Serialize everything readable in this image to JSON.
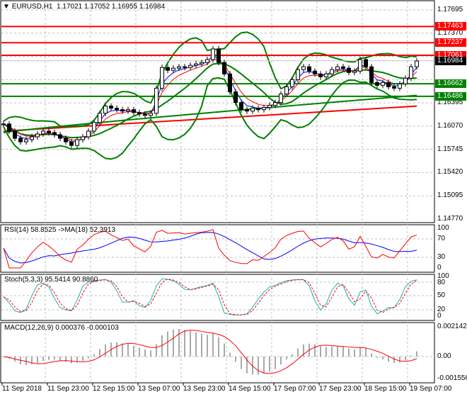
{
  "header": {
    "symbol": "EURUSD,H1",
    "open": "1.17021",
    "high": "1.17052",
    "low": "1.16955",
    "close": "1.16984"
  },
  "price_axis": [
    "1.17695",
    "1.17370",
    "1.16395",
    "1.16070",
    "1.15745",
    "1.15420",
    "1.15095",
    "1.14770"
  ],
  "levels": [
    {
      "price": 1.17463,
      "label": "1.17463",
      "color": "#ff0000"
    },
    {
      "price": 1.17237,
      "label": "1.17237",
      "color": "#ff0000"
    },
    {
      "price": 1.17061,
      "label": "1.17061",
      "color": "#ff0000"
    },
    {
      "price": 1.16662,
      "label": "1.16662",
      "color": "#008000"
    },
    {
      "price": 1.16486,
      "label": "1.16486",
      "color": "#008000"
    }
  ],
  "current_price": {
    "price": 1.16984,
    "label": "1.16984"
  },
  "rsi": {
    "title": "RSI(14) 58.8525  ->MA(18) 52.3913",
    "axis": [
      "100",
      "70",
      "30",
      "0"
    ]
  },
  "stoch": {
    "title": "Stoch(5,3,3) 95.5414 90.8860",
    "axis": [
      "100",
      "80",
      "50",
      "20",
      "0"
    ]
  },
  "macd": {
    "title": "MACD(12,26,9) 0.000376 -0.000103",
    "axis": [
      "0.002142",
      "0.00",
      "-0.001556"
    ]
  },
  "time_axis": [
    "11 Sep 2018",
    "11 Sep 23:00",
    "12 Sep 15:00",
    "13 Sep 07:00",
    "13 Sep 23:00",
    "14 Sep 15:00",
    "17 Sep 07:00",
    "17 Sep 23:00",
    "18 Sep 15:00",
    "19 Sep 07:00"
  ],
  "chart_data": {
    "type": "candlestick",
    "closes": [
      1.161,
      1.16,
      1.159,
      1.1585,
      1.1588,
      1.1592,
      1.1596,
      1.16,
      1.1598,
      1.1595,
      1.159,
      1.1585,
      1.158,
      1.1588,
      1.1592,
      1.16,
      1.1612,
      1.1625,
      1.1635,
      1.1632,
      1.163,
      1.1628,
      1.163,
      1.1626,
      1.1624,
      1.1622,
      1.1625,
      1.166,
      1.1689,
      1.1685,
      1.1688,
      1.169,
      1.1689,
      1.1692,
      1.1694,
      1.1696,
      1.17,
      1.1715,
      1.1696,
      1.168,
      1.1655,
      1.164,
      1.163,
      1.1628,
      1.1632,
      1.163,
      1.1633,
      1.1636,
      1.164,
      1.1652,
      1.1662,
      1.1672,
      1.1686,
      1.169,
      1.1684,
      1.168,
      1.1676,
      1.168,
      1.1686,
      1.169,
      1.1688,
      1.1682,
      1.1684,
      1.17,
      1.169,
      1.1668,
      1.1664,
      1.1668,
      1.1662,
      1.166,
      1.1666,
      1.1674,
      1.169,
      1.1698
    ],
    "ylim": [
      1.1477,
      1.17695
    ]
  }
}
